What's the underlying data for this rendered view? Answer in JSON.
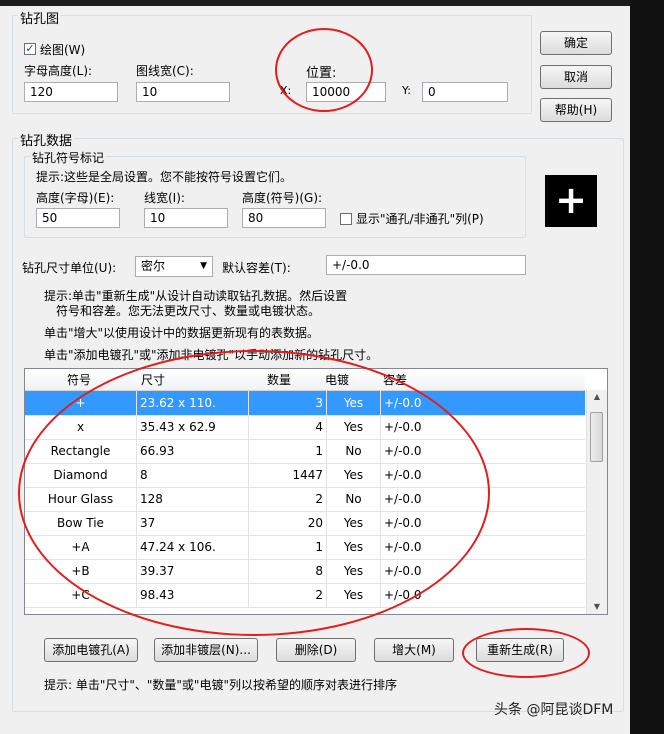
{
  "drill_chart": {
    "title": "钻孔图",
    "draw_checkbox": {
      "label": "绘图(W)",
      "checked": true
    },
    "char_height": {
      "label": "字母高度(L):",
      "value": "120"
    },
    "line_width": {
      "label": "图线宽(C):",
      "value": "10"
    },
    "position": {
      "label": "位置:",
      "x_label": "X:",
      "x_value": "10000",
      "y_label": "Y:",
      "y_value": "0"
    }
  },
  "buttons": {
    "ok": "确定",
    "cancel": "取消",
    "help": "帮助(H)"
  },
  "drill_data": {
    "title": "钻孔数据",
    "symbol_group": {
      "title": "钻孔符号标记",
      "hint": "提示:这些是全局设置。您不能按符号设置它们。",
      "height_char": {
        "label": "高度(字母)(E):",
        "value": "50"
      },
      "line_width": {
        "label": "线宽(I):",
        "value": "10"
      },
      "height_symbol": {
        "label": "高度(符号)(G):",
        "value": "80"
      },
      "show_plated_checkbox": {
        "label": "显示\"通孔/非通孔\"列(P)",
        "checked": false
      },
      "preview_symbol": "+"
    },
    "unit": {
      "label": "钻孔尺寸单位(U):",
      "value": "密尔"
    },
    "tolerance": {
      "label": "默认容差(T):",
      "value": "+/-0.0"
    },
    "hints": [
      "提示:单击\"重新生成\"从设计自动读取钻孔数据。然后设置",
      "符号和容差。您无法更改尺寸、数量或电镀状态。",
      "单击\"增大\"以使用设计中的数据更新现有的表数据。",
      "单击\"添加电镀孔\"或\"添加非电镀孔\"以手动添加新的钻孔尺寸。"
    ]
  },
  "table": {
    "columns": [
      "符号",
      "尺寸",
      "数量",
      "电镀",
      "容差"
    ],
    "rows": [
      {
        "symbol": "+",
        "size": "23.62 x 110.",
        "count": "3",
        "plated": "Yes",
        "tolerance": "+/-0.0",
        "selected": true
      },
      {
        "symbol": "x",
        "size": "35.43 x 62.9",
        "count": "4",
        "plated": "Yes",
        "tolerance": "+/-0.0"
      },
      {
        "symbol": "Rectangle",
        "size": "66.93",
        "count": "1",
        "plated": "No",
        "tolerance": "+/-0.0"
      },
      {
        "symbol": "Diamond",
        "size": "8",
        "count": "1447",
        "plated": "Yes",
        "tolerance": "+/-0.0"
      },
      {
        "symbol": "Hour Glass",
        "size": "128",
        "count": "2",
        "plated": "No",
        "tolerance": "+/-0.0"
      },
      {
        "symbol": "Bow Tie",
        "size": "37",
        "count": "20",
        "plated": "Yes",
        "tolerance": "+/-0.0"
      },
      {
        "symbol": "+A",
        "size": "47.24 x 106.",
        "count": "1",
        "plated": "Yes",
        "tolerance": "+/-0.0"
      },
      {
        "symbol": "+B",
        "size": "39.37",
        "count": "8",
        "plated": "Yes",
        "tolerance": "+/-0.0"
      },
      {
        "symbol": "+C",
        "size": "98.43",
        "count": "2",
        "plated": "Yes",
        "tolerance": "+/-0.0"
      }
    ]
  },
  "actions": {
    "add_plated": "添加电镀孔(A)",
    "add_nonplated": "添加非镀层(N)...",
    "delete": "删除(D)",
    "enlarge": "增大(M)",
    "regenerate": "重新生成(R)"
  },
  "footer_hint": "提示: 单击\"尺寸\"、\"数量\"或\"电镀\"列以按希望的顺序对表进行排序",
  "watermark": "头条 @阿昆谈DFM",
  "colors": {
    "selection": "#3399ff",
    "annotation": "#e41c1c"
  }
}
